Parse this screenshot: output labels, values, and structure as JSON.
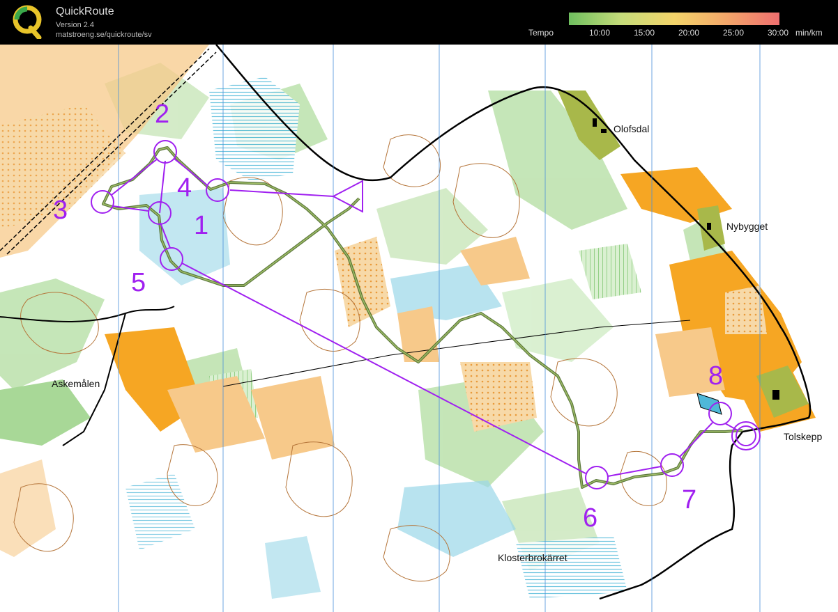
{
  "header": {
    "app_name": "QuickRoute",
    "version": "Version 2.4",
    "url": "matstroeng.se/quickroute/sv",
    "tempo_label": "Tempo",
    "tempo_ticks": [
      "10:00",
      "15:00",
      "20:00",
      "25:00",
      "30:00",
      "min/km"
    ],
    "tempo_colors": [
      "#6fbf5f",
      "#c6dc7a",
      "#f3d46a",
      "#f3a66a",
      "#ef6f6f"
    ]
  },
  "map": {
    "place_names": [
      "Olofsdal",
      "Nybygget",
      "Askemålen",
      "Tolskepp",
      "Klosterbrokärret"
    ],
    "control_numbers": [
      "2",
      "4",
      "3",
      "1",
      "5",
      "8",
      "7",
      "6"
    ],
    "colors": {
      "course": "#a020f0",
      "route": "#4d6b2a",
      "open_land": "#f7c98a",
      "rough_open": "#f6a623",
      "green": "#bfe3b0",
      "marsh": "#9ad7e8",
      "contour": "#b5753a"
    }
  }
}
